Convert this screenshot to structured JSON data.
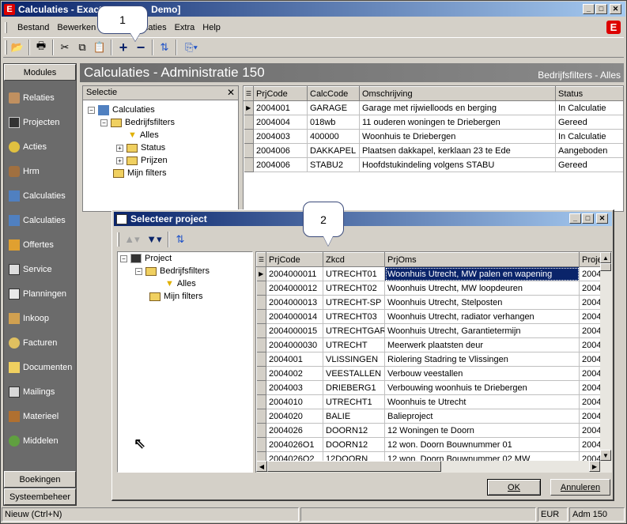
{
  "app": {
    "title": "Calculaties - Exact [Demo]",
    "title_left": "Calculaties - Exact",
    "title_right": "Demo]"
  },
  "menu": [
    "Bestand",
    "Bewerken",
    "Calculaties",
    "Extra",
    "Help"
  ],
  "menu_visible": {
    "bestand": "Bestand",
    "bewerken": "Bewerken",
    "calc_partial": "culaties",
    "extra": "Extra",
    "help": "Help"
  },
  "callouts": {
    "one": "1",
    "two": "2"
  },
  "nav": {
    "header": "Modules",
    "items": [
      "Relaties",
      "Projecten",
      "Acties",
      "Hrm",
      "Calculaties",
      "Calculaties",
      "Offertes",
      "Service",
      "Planningen",
      "Inkoop",
      "Facturen",
      "Documenten",
      "Mailings",
      "Materieel",
      "Middelen"
    ],
    "bottom": [
      "Boekingen",
      "Systeembeheer"
    ]
  },
  "page": {
    "title": "Calculaties - Administratie 150",
    "filter": "Bedrijfsfilters - Alles"
  },
  "selectie": {
    "title": "Selectie",
    "close": "✕",
    "tree": {
      "root": "Calculaties",
      "bedrijfsfilters": "Bedrijfsfilters",
      "alles": "Alles",
      "status": "Status",
      "prijzen": "Prijzen",
      "mijn": "Mijn filters"
    }
  },
  "calc_table": {
    "headers": [
      "PrjCode",
      "CalcCode",
      "Omschrijving",
      "Status"
    ],
    "rows": [
      [
        "2004001",
        "GARAGE",
        "Garage met rijwielloods en berging",
        "In Calculatie"
      ],
      [
        "2004004",
        "018wb",
        "11 ouderen woningen te Driebergen",
        "Gereed"
      ],
      [
        "2004003",
        "400000",
        "Woonhuis te Driebergen",
        "In Calculatie"
      ],
      [
        "2004006",
        "DAKKAPEL",
        "Plaatsen dakkapel, kerklaan 23 te Ede",
        "Aangeboden"
      ],
      [
        "2004006",
        "STABU2",
        "Hoofdstukindeling volgens STABU",
        "Gereed"
      ]
    ]
  },
  "dialog": {
    "title": "Selecteer project",
    "tree": {
      "root": "Project",
      "bedrijfsfilters": "Bedrijfsfilters",
      "alles": "Alles",
      "mijn": "Mijn filters"
    },
    "headers": [
      "PrjCode",
      "Zkcd",
      "PrjOms",
      "Proje"
    ],
    "rows": [
      [
        "2004000011",
        "UTRECHT01",
        "Woonhuis Utrecht, MW palen en wapening",
        "2004"
      ],
      [
        "2004000012",
        "UTRECHT02",
        "Woonhuis Utrecht, MW loopdeuren",
        "2004"
      ],
      [
        "2004000013",
        "UTRECHT-SP",
        "Woonhuis Utrecht, Stelposten",
        "2004"
      ],
      [
        "2004000014",
        "UTRECHT03",
        "Woonhuis Utrecht, radiator verhangen",
        "2004"
      ],
      [
        "2004000015",
        "UTRECHTGAR",
        "Woonhuis Utrecht, Garantietermijn",
        "2004"
      ],
      [
        "2004000030",
        "UTRECHT",
        "Meerwerk plaatsten deur",
        "2004"
      ],
      [
        "2004001",
        "VLISSINGEN",
        "Riolering Stadring te Vlissingen",
        "2004"
      ],
      [
        "2004002",
        "VEESTALLEN",
        "Verbouw veestallen",
        "2004"
      ],
      [
        "2004003",
        "DRIEBERG1",
        "Verbouwing woonhuis te Driebergen",
        "2004"
      ],
      [
        "2004010",
        "UTRECHT1",
        "Woonhuis te Utrecht",
        "2004"
      ],
      [
        "2004020",
        "BALIE",
        "Balieproject",
        "2004"
      ],
      [
        "2004026",
        "DOORN12",
        "12 Woningen te Doorn",
        "2004"
      ],
      [
        "2004026O1",
        "DOORN12",
        "12 won. Doorn Bouwnummer 01",
        "2004"
      ],
      [
        "2004026O2",
        "12DOORN",
        "12 won. Doorn Bouwnummer 02 MW",
        "2004"
      ]
    ],
    "ok": "OK",
    "cancel": "Annuleren"
  },
  "status": {
    "hint": "Nieuw (Ctrl+N)",
    "currency": "EUR",
    "admin": "Adm 150"
  },
  "colors": {
    "accent": "#0a246a",
    "nav_bg": "#6b6b6b",
    "panel_gray": "#d4d0c8",
    "selection": "#0a246a"
  }
}
